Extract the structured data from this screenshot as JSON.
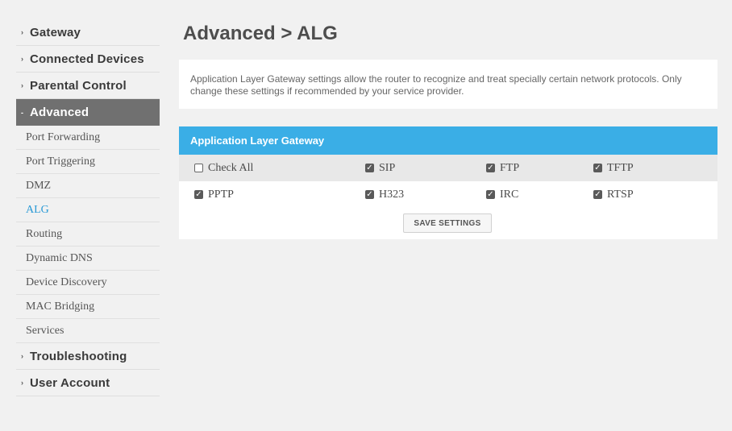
{
  "sidebar": {
    "top_items": [
      {
        "label": "Gateway"
      },
      {
        "label": "Connected Devices"
      },
      {
        "label": "Parental Control"
      },
      {
        "label": "Advanced"
      },
      {
        "label": "Troubleshooting"
      },
      {
        "label": "User Account"
      }
    ],
    "sub_items": [
      {
        "label": "Port Forwarding"
      },
      {
        "label": "Port Triggering"
      },
      {
        "label": "DMZ"
      },
      {
        "label": "ALG"
      },
      {
        "label": "Routing"
      },
      {
        "label": "Dynamic DNS"
      },
      {
        "label": "Device Discovery"
      },
      {
        "label": "MAC Bridging"
      },
      {
        "label": "Services"
      }
    ],
    "collapsed_caret": "›",
    "expanded_caret": "-",
    "active_top": "Advanced",
    "selected_sub": "ALG"
  },
  "main": {
    "title": "Advanced > ALG",
    "description": "Application Layer Gateway settings allow the router to recognize and treat specially certain network protocols. Only change these settings if recommended by your service provider."
  },
  "alg": {
    "header": "Application Layer Gateway",
    "options": [
      {
        "label": "Check All",
        "checked": false
      },
      {
        "label": "SIP",
        "checked": true
      },
      {
        "label": "FTP",
        "checked": true
      },
      {
        "label": "TFTP",
        "checked": true
      },
      {
        "label": "PPTP",
        "checked": true
      },
      {
        "label": "H323",
        "checked": true
      },
      {
        "label": "IRC",
        "checked": true
      },
      {
        "label": "RTSP",
        "checked": true
      }
    ],
    "check_glyph": "✓",
    "save_label": "SAVE SETTINGS"
  },
  "colors": {
    "accent": "#3aaee6",
    "active_nav": "#707070",
    "selected_link": "#2a9ad6"
  }
}
